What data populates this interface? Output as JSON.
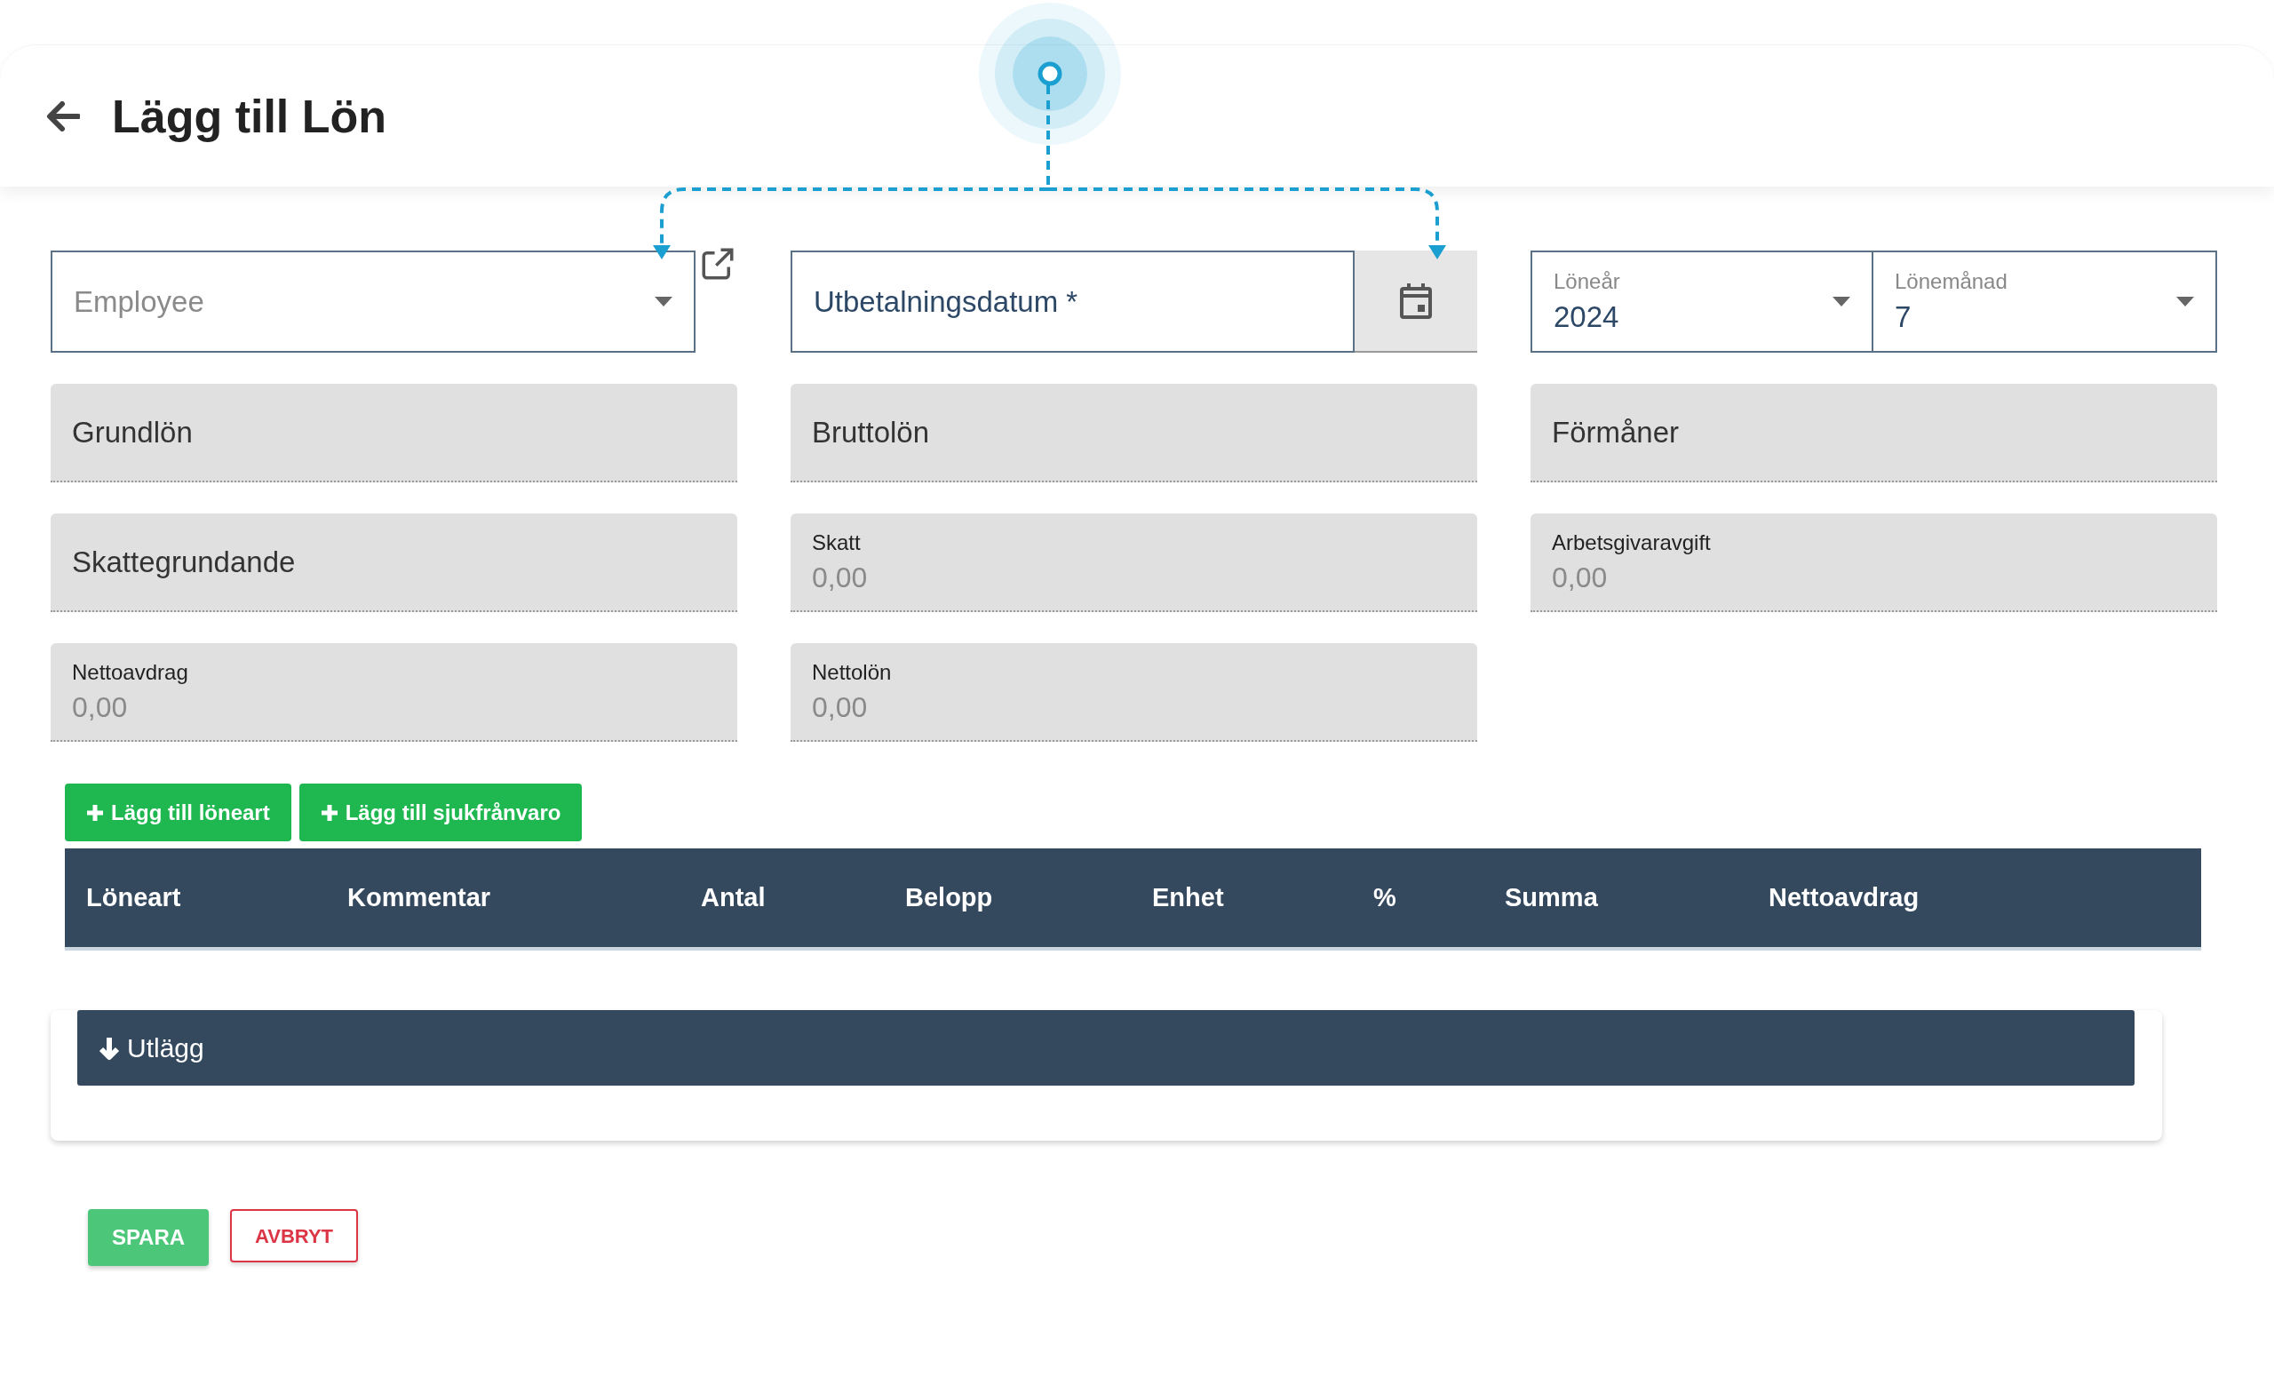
{
  "header": {
    "title": "Lägg till Lön"
  },
  "employee": {
    "placeholder": "Employee"
  },
  "payout_date": {
    "placeholder": "Utbetalningsdatum *"
  },
  "year": {
    "label": "Löneår",
    "value": "2024"
  },
  "month": {
    "label": "Lönemånad",
    "value": "7"
  },
  "readonly_fields": [
    {
      "label": "Grundlön"
    },
    {
      "label": "Bruttolön"
    },
    {
      "label": "Förmåner"
    },
    {
      "label": "Skattegrundande"
    },
    {
      "label": "Skatt",
      "value": "0,00"
    },
    {
      "label": "Arbetsgivaravgift",
      "value": "0,00"
    },
    {
      "label": "Nettoavdrag",
      "value": "0,00"
    },
    {
      "label": "Nettolön",
      "value": "0,00"
    }
  ],
  "add_buttons": [
    "Lägg till löneart",
    "Lägg till sjukfrånvaro"
  ],
  "table": {
    "columns": [
      "Löneart",
      "Kommentar",
      "Antal",
      "Belopp",
      "Enhet",
      "%",
      "Summa",
      "Nettoavdrag"
    ]
  },
  "expenses_section": {
    "title": "Utlägg"
  },
  "actions": {
    "save": "SPARA",
    "cancel": "AVBRYT"
  }
}
